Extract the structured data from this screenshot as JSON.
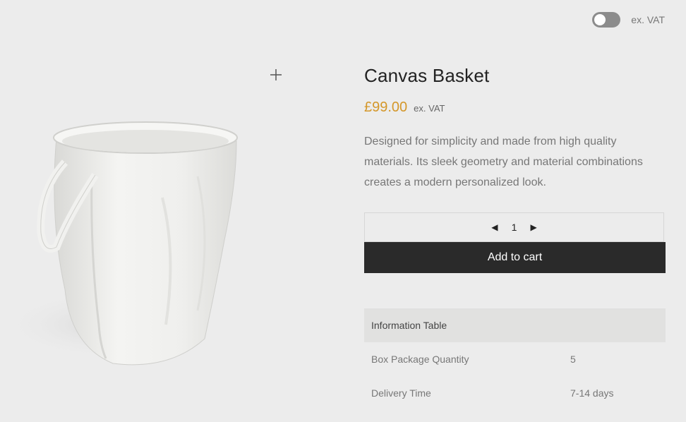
{
  "header": {
    "vat_toggle_label": "ex. VAT",
    "vat_toggle_on": false
  },
  "product": {
    "title": "Canvas Basket",
    "price": "£99.00",
    "price_suffix": "ex. VAT",
    "description": "Designed for simplicity and made from high quality materials. Its sleek geometry and material combinations creates a modern personalized look.",
    "quantity": "1",
    "qty_decrement": "◀",
    "qty_increment": "▶",
    "add_to_cart_label": "Add to cart"
  },
  "info_table": {
    "header": "Information Table",
    "rows": [
      {
        "label": "Box Package Quantity",
        "value": "5"
      },
      {
        "label": "Delivery Time",
        "value": "7-14 days"
      }
    ]
  },
  "icons": {
    "zoom": "plus-icon"
  },
  "colors": {
    "price": "#d4972a",
    "button_bg": "#2a2a2a",
    "page_bg": "#ececec"
  }
}
